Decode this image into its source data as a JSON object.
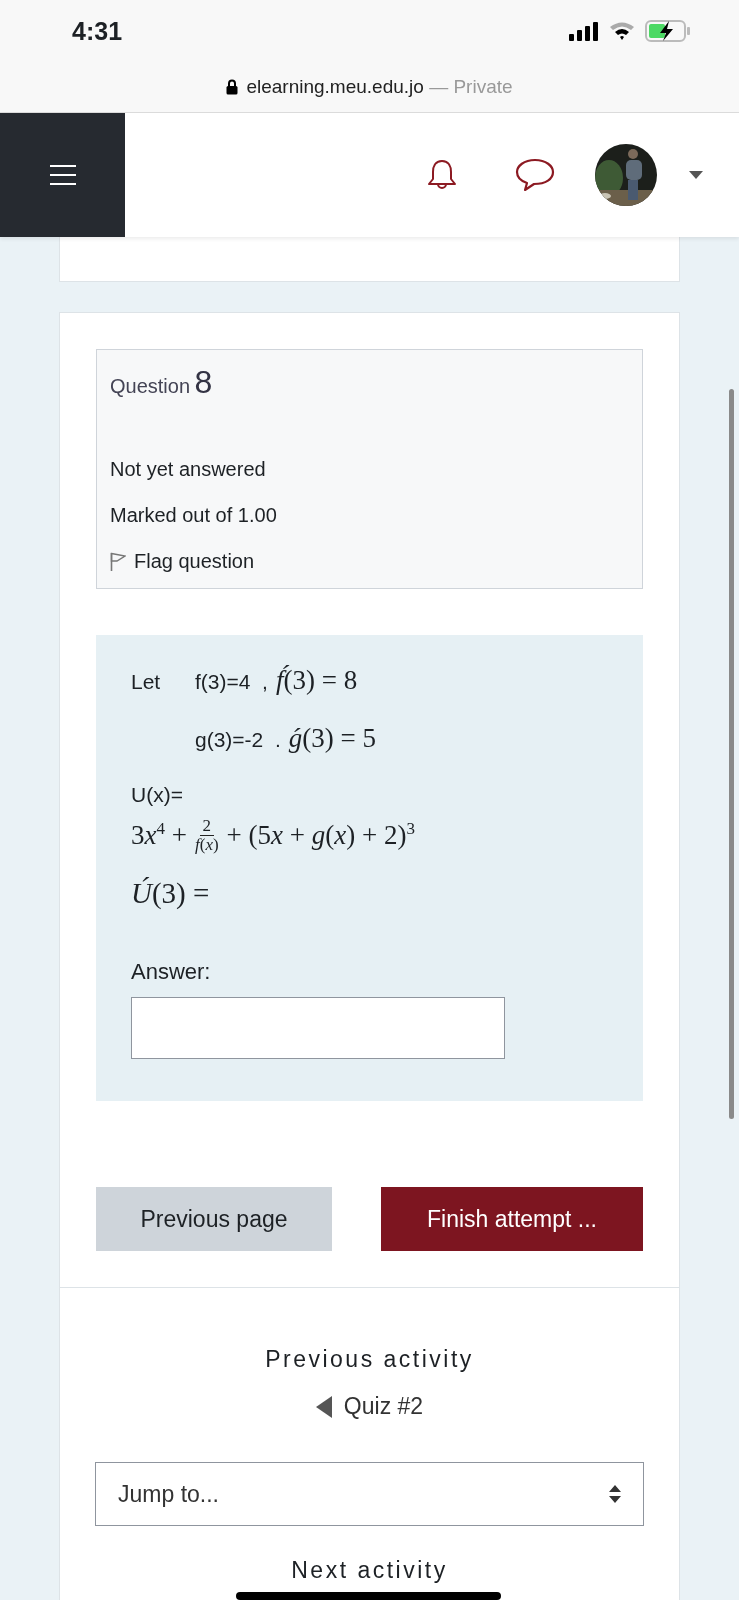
{
  "status_bar": {
    "time": "4:31"
  },
  "address_bar": {
    "domain": "elearning.meu.edu.jo",
    "suffix": "— Private"
  },
  "question_info": {
    "label": "Question",
    "number": "8",
    "state": "Not yet answered",
    "marks": "Marked out of 1.00",
    "flag": {
      "label": "Flag question",
      "flagged": false
    }
  },
  "question_text": {
    "intro": "Let",
    "givens": [
      {
        "plain": "f(3)=4  ,",
        "math": "*f́*(3) = 8"
      },
      {
        "plain": "g(3)=-2  .",
        "math": "*ǵ*(3) = 5"
      }
    ],
    "function_label": "U(x)=",
    "expression": {
      "before": [
        {
          "text": "3",
          "kind": "num"
        },
        {
          "text": "x",
          "kind": "var"
        },
        {
          "text": "4",
          "kind": "sup"
        },
        {
          "text": " +",
          "kind": "num"
        }
      ],
      "numerator": "2",
      "denominator": "*f*(*x*)",
      "after": [
        {
          "text": "+ (5",
          "kind": "num"
        },
        {
          "text": "x",
          "kind": "var"
        },
        {
          "text": " + ",
          "kind": "num"
        },
        {
          "text": "g",
          "kind": "var"
        },
        {
          "text": "(",
          "kind": "num"
        },
        {
          "text": "x",
          "kind": "var"
        },
        {
          "text": ") + 2)",
          "kind": "num"
        },
        {
          "text": "3",
          "kind": "sup"
        }
      ]
    },
    "query": "*Ú*(3) =",
    "answer_label": "Answer:"
  },
  "buttons": [
    {
      "label": "Previous page",
      "kind": "secondary"
    },
    {
      "label": "Finish attempt ...",
      "kind": "primary"
    }
  ],
  "activity_nav": {
    "previous_heading": "Previous activity",
    "previous_link": "Quiz #2",
    "jump_placeholder": "Jump to...",
    "next_heading": "Next activity"
  }
}
